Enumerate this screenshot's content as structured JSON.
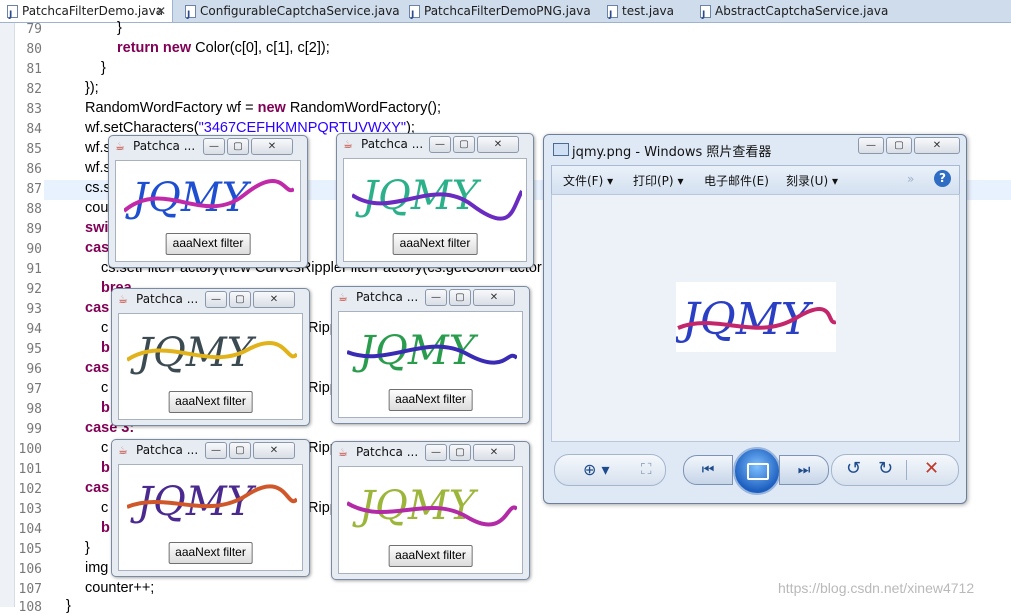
{
  "tabs": [
    {
      "label": "PatchcaFilterDemo.java",
      "close": "✕"
    },
    {
      "label": "ConfigurableCaptchaService.java"
    },
    {
      "label": "PatchcaFilterDemoPNG.java"
    },
    {
      "label": "test.java"
    },
    {
      "label": "AbstractCaptchaService.java"
    }
  ],
  "editor": {
    "line_numbers": [
      "79",
      "80",
      "81",
      "82",
      "83",
      "84",
      "85",
      "86",
      "87",
      "88",
      "89",
      "90",
      "91",
      "92",
      "93",
      "94",
      "95",
      "96",
      "97",
      "98",
      "99",
      "100",
      "101",
      "102",
      "103",
      "104",
      "105",
      "106",
      "107",
      "108"
    ],
    "code": {
      "l79": "}",
      "l80_kw": "return new",
      "l80_rest": " Color(c[0], c[1], c[2]);",
      "l81": "}",
      "l82": "});",
      "l83_a": "RandomWordFactory wf = ",
      "l83_kw": "new",
      "l83_b": " RandomWordFactory();",
      "l84_a": "wf.setCharacters(",
      "l84_str": "\"3467CEFHKMNPQRTUVWXY\"",
      "l84_b": ");",
      "l85": "wf.s",
      "l86": "wf.s",
      "l87": "cs.s",
      "l88": "cou",
      "l89": "swi",
      "l90": "cas",
      "l91": "cs.setFilterFactory(new CurvesRippleFilterFactory(cs.getColorFactor",
      "l92": "brea",
      "l93": "cas",
      "l94a": "c",
      "l94b": "Ripp",
      "l95": "b",
      "l96": "cas",
      "l97a": "c",
      "l97b": "Ripp",
      "l98": "b",
      "l99": "case 3:",
      "l100a": "c",
      "l100b": "Ripp",
      "l101": "b",
      "l102": "cas",
      "l103a": "c",
      "l103b": "Ripp",
      "l104": "b",
      "l105": "}",
      "l106": "img",
      "l106b": ";",
      "l107": "counter++;",
      "l108": "}"
    }
  },
  "patchca_windows": [
    {
      "title": "Patchca ...",
      "button": "aaaNext filter",
      "captcha": "JQMY"
    },
    {
      "title": "Patchca ...",
      "button": "aaaNext filter",
      "captcha": "JQMY"
    },
    {
      "title": "Patchca ...",
      "button": "aaaNext filter",
      "captcha": "JQMY"
    },
    {
      "title": "Patchca ...",
      "button": "aaaNext filter",
      "captcha": "JQMY"
    },
    {
      "title": "Patchca ...",
      "button": "aaaNext filter",
      "captcha": "JQMY"
    },
    {
      "title": "Patchca ...",
      "button": "aaaNext filter",
      "captcha": "JQMY"
    }
  ],
  "window_buttons": {
    "minimize": "—",
    "maximize": "▢",
    "close": "✕"
  },
  "viewer": {
    "title": "jqmy.png - Windows 照片查看器",
    "menu": [
      "文件(F)",
      "打印(P)",
      "电子邮件(E)",
      "刻录(U)"
    ],
    "menu_arrows": [
      "▾",
      "▾",
      "",
      "▾"
    ],
    "more": "»",
    "help": "?",
    "image_text": "JQMY",
    "toolbar": {
      "zoom": "⊕ ▾",
      "fit": "⛶",
      "prev": "⏮",
      "next": "⏭",
      "rotate_left": "↺",
      "rotate_right": "↻",
      "delete": "✕"
    }
  },
  "watermark": "https://blog.csdn.net/xinew4712",
  "colors": {
    "keyword": "#7f0055",
    "string": "#2a00ff",
    "delete": "#c0392b"
  }
}
